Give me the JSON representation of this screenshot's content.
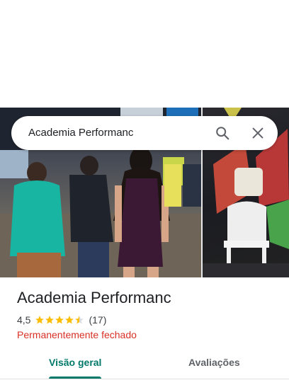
{
  "search": {
    "query": "Academia Performanc"
  },
  "place": {
    "title": "Academia Performanc",
    "rating": "4,5",
    "rating_value": 4.5,
    "review_count": "(17)",
    "status": "Permanentemente fechado"
  },
  "tabs": [
    {
      "label": "Visão geral",
      "active": true
    },
    {
      "label": "Avaliações",
      "active": false
    }
  ],
  "colors": {
    "accent": "#00796b",
    "closed": "#d93025",
    "star": "#fbbc04"
  },
  "icons": {
    "search": "search-icon",
    "close": "close-icon",
    "star": "star-icon"
  }
}
